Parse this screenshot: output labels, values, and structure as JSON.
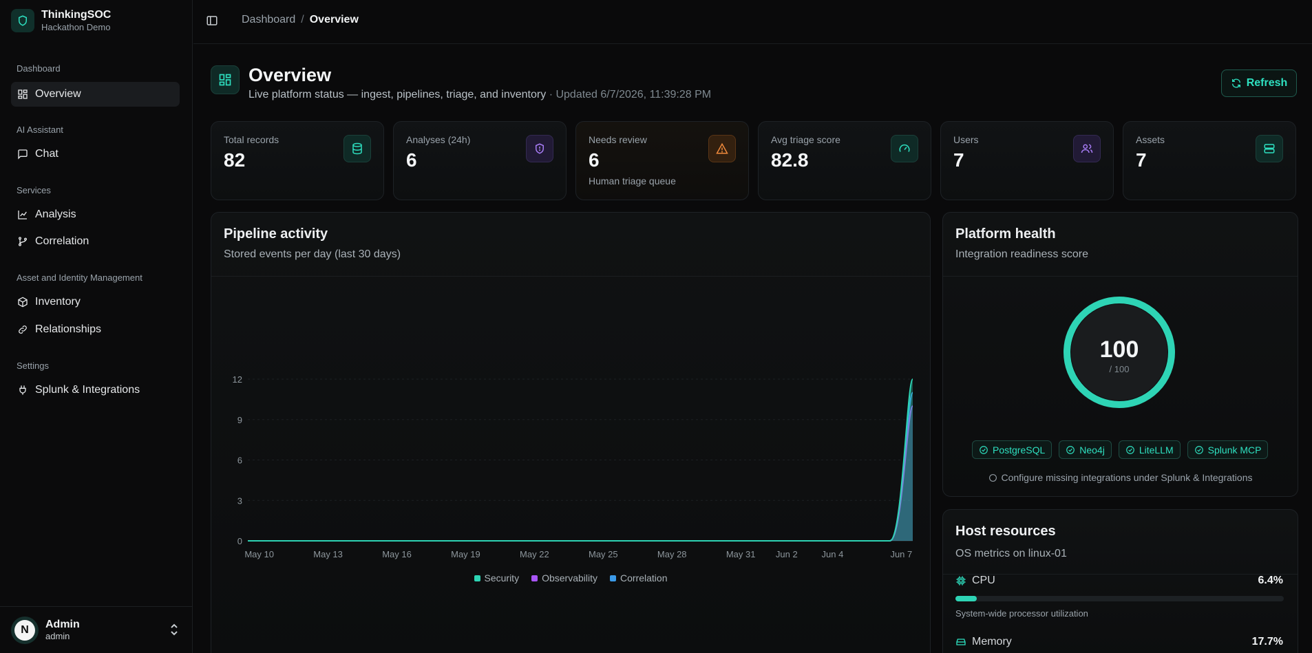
{
  "brand": {
    "name": "ThinkingSOC",
    "subtitle": "Hackathon Demo"
  },
  "nav": {
    "groups": [
      {
        "label": "Dashboard",
        "items": [
          {
            "label": "Overview",
            "icon": "layout-grid-icon",
            "active": true
          }
        ]
      },
      {
        "label": "AI Assistant",
        "items": [
          {
            "label": "Chat",
            "icon": "chat-icon"
          }
        ]
      },
      {
        "label": "Services",
        "items": [
          {
            "label": "Analysis",
            "icon": "line-chart-icon"
          },
          {
            "label": "Correlation",
            "icon": "git-branch-icon"
          }
        ]
      },
      {
        "label": "Asset and Identity Management",
        "items": [
          {
            "label": "Inventory",
            "icon": "box-icon"
          },
          {
            "label": "Relationships",
            "icon": "link-icon"
          }
        ]
      },
      {
        "label": "Settings",
        "items": [
          {
            "label": "Splunk & Integrations",
            "icon": "plug-icon"
          }
        ]
      }
    ]
  },
  "user": {
    "initial": "N",
    "name": "Admin",
    "role": "admin"
  },
  "breadcrumb": {
    "parent": "Dashboard",
    "separator": "/",
    "current": "Overview"
  },
  "header": {
    "title": "Overview",
    "subtitle": "Live platform status — ingest, pipelines, triage, and inventory",
    "updated": "· Updated 6/7/2026, 11:39:28 PM",
    "refresh_label": "Refresh"
  },
  "stats": [
    {
      "label": "Total records",
      "value": "82",
      "note": "",
      "icon": "database-icon"
    },
    {
      "label": "Analyses (24h)",
      "value": "6",
      "note": "",
      "icon": "shield-icon"
    },
    {
      "label": "Needs review",
      "value": "6",
      "note": "Human triage queue",
      "icon": "alert-triangle-icon"
    },
    {
      "label": "Avg triage score",
      "value": "82.8",
      "note": "",
      "icon": "gauge-icon"
    },
    {
      "label": "Users",
      "value": "7",
      "note": "",
      "icon": "users-icon"
    },
    {
      "label": "Assets",
      "value": "7",
      "note": "",
      "icon": "server-icon"
    }
  ],
  "pipeline": {
    "title": "Pipeline activity",
    "subtitle": "Stored events per day (last 30 days)"
  },
  "chart_data": {
    "type": "area",
    "title": "Pipeline activity",
    "subtitle": "Stored events per day (last 30 days)",
    "x_tick_labels": [
      "May 10",
      "May 13",
      "May 16",
      "May 19",
      "May 22",
      "May 25",
      "May 28",
      "May 31",
      "Jun 2",
      "Jun 4",
      "Jun 7"
    ],
    "y_ticks": [
      0,
      3,
      6,
      9,
      12
    ],
    "ylim": [
      0,
      12
    ],
    "x": [
      "May 9",
      "Jun 6",
      "Jun 7"
    ],
    "series": [
      {
        "name": "Security",
        "color": "#2dd4b4",
        "values": [
          0,
          0,
          12
        ]
      },
      {
        "name": "Observability",
        "color": "#a855f7",
        "values": [
          0,
          0,
          10
        ]
      },
      {
        "name": "Correlation",
        "color": "#3b9ae8",
        "values": [
          0,
          0,
          11
        ]
      }
    ],
    "grid": true,
    "legend": "bottom"
  },
  "health": {
    "title": "Platform health",
    "subtitle": "Integration readiness score",
    "score": "100",
    "score_max": "/ 100",
    "score_fraction": 1.0,
    "integrations": [
      "PostgreSQL",
      "Neo4j",
      "LiteLLM",
      "Splunk MCP"
    ],
    "config_note": "Configure missing integrations under Splunk & Integrations"
  },
  "host": {
    "title": "Host resources",
    "subtitle": "OS metrics on linux-01",
    "cpu": {
      "label": "CPU",
      "value": "6.4%",
      "fraction": 0.064,
      "desc": "System-wide processor utilization"
    },
    "memory": {
      "label": "Memory",
      "value": "17.7%",
      "fraction": 0.177
    }
  },
  "colors": {
    "accent": "#2ee0c0",
    "purple": "#a77cf5",
    "orange": "#f08a3c"
  }
}
